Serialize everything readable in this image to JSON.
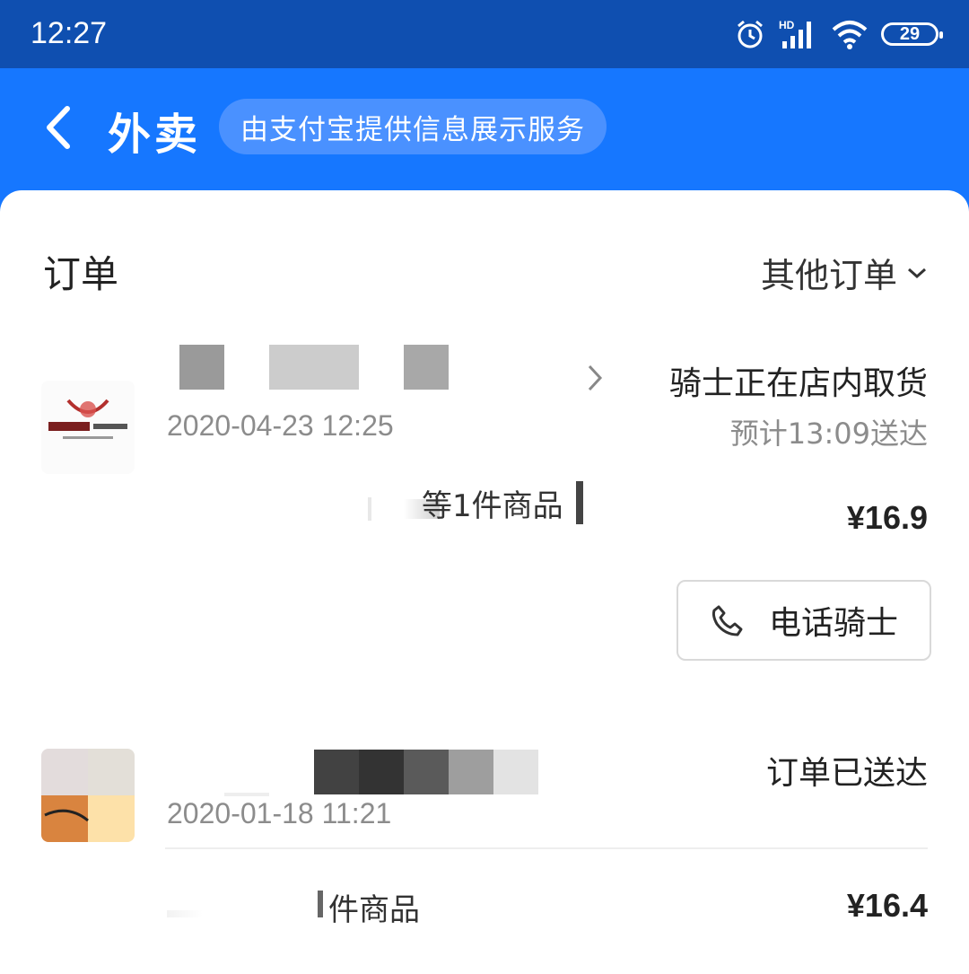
{
  "status_bar": {
    "time": "12:27",
    "network": "HD",
    "battery": "29"
  },
  "header": {
    "title": "外卖",
    "provider_note": "由支付宝提供信息展示服务"
  },
  "section": {
    "title": "订单",
    "filter_label": "其他订单"
  },
  "orders": [
    {
      "date": "2020-04-23 12:25",
      "status": "骑士正在店内取货",
      "eta": "预计13:09送达",
      "items": "等1件商品",
      "price": "¥16.9",
      "call_label": "电话骑士"
    },
    {
      "date": "2020-01-18 11:21",
      "status": "订单已送达",
      "items": "件商品",
      "price": "¥16.4"
    }
  ],
  "colors": {
    "brand_blue": "#1677ff",
    "status_bar": "#0f4fb0"
  }
}
